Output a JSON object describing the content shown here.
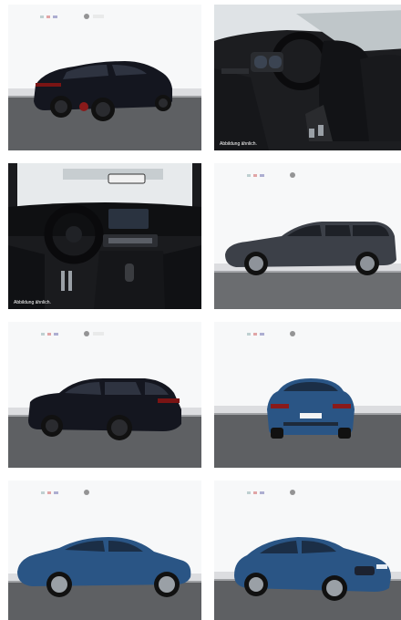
{
  "gallery": {
    "tiles": [
      {
        "label": "BMW X4 rear three-quarter view, black",
        "caption": ""
      },
      {
        "label": "BMW X3 interior, front seats",
        "caption": "Abbildung ähnlich."
      },
      {
        "label": "BMW X3 dashboard and cockpit",
        "caption": "Abbildung ähnlich."
      },
      {
        "label": "BMW 3 Series Touring side view, grey",
        "caption": ""
      },
      {
        "label": "BMW X3 rear three-quarter view, black",
        "caption": ""
      },
      {
        "label": "BMW X3 rear view, blue",
        "caption": ""
      },
      {
        "label": "BMW X4 side view, blue",
        "caption": ""
      },
      {
        "label": "BMW X4 front three-quarter view, blue",
        "caption": ""
      }
    ]
  },
  "colors": {
    "studio_wall": "#f7f8f9",
    "floor": "#5e6063",
    "car_black": "#14161f",
    "car_grey": "#3c4048",
    "car_blue": "#2a5585",
    "interior": "#1c1d20"
  }
}
